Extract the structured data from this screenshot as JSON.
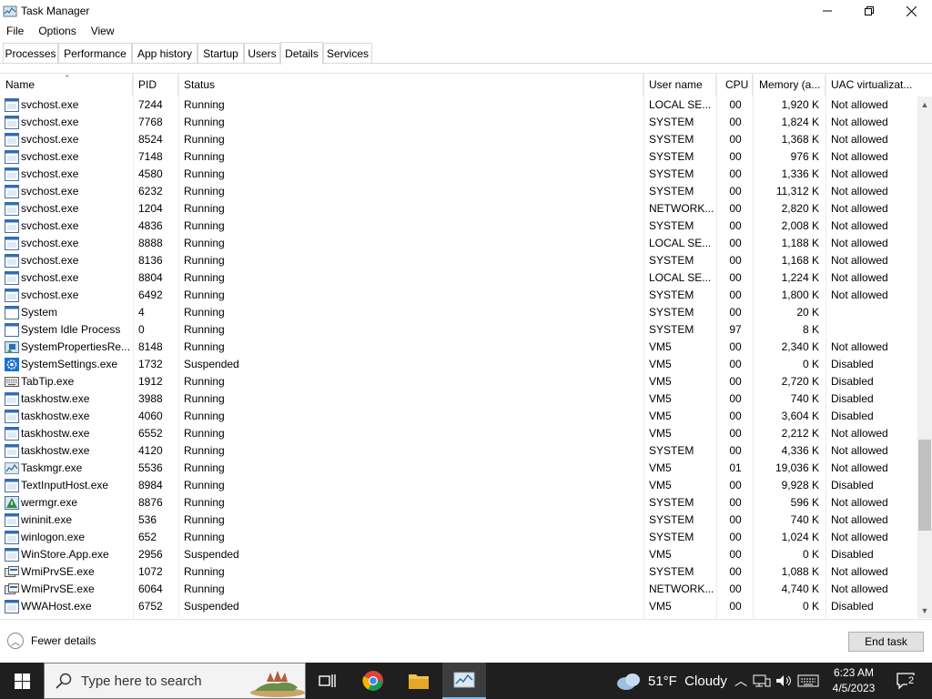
{
  "window": {
    "title": "Task Manager"
  },
  "menu": [
    "File",
    "Options",
    "View"
  ],
  "tabs": [
    {
      "label": "Processes"
    },
    {
      "label": "Performance"
    },
    {
      "label": "App history"
    },
    {
      "label": "Startup"
    },
    {
      "label": "Users"
    },
    {
      "label": "Details",
      "active": true
    },
    {
      "label": "Services"
    }
  ],
  "columns": {
    "name": "Name",
    "pid": "PID",
    "status": "Status",
    "user": "User name",
    "cpu": "CPU",
    "memory": "Memory (a...",
    "uac": "UAC virtualizat..."
  },
  "processes": [
    {
      "name": "svchost.exe",
      "pid": "7244",
      "status": "Running",
      "user": "LOCAL SE...",
      "cpu": "00",
      "memory": "1,920 K",
      "uac": "Not allowed",
      "icon": "svchost-icon"
    },
    {
      "name": "svchost.exe",
      "pid": "7768",
      "status": "Running",
      "user": "SYSTEM",
      "cpu": "00",
      "memory": "1,824 K",
      "uac": "Not allowed",
      "icon": "svchost-icon"
    },
    {
      "name": "svchost.exe",
      "pid": "8524",
      "status": "Running",
      "user": "SYSTEM",
      "cpu": "00",
      "memory": "1,368 K",
      "uac": "Not allowed",
      "icon": "svchost-icon"
    },
    {
      "name": "svchost.exe",
      "pid": "7148",
      "status": "Running",
      "user": "SYSTEM",
      "cpu": "00",
      "memory": "976 K",
      "uac": "Not allowed",
      "icon": "svchost-icon"
    },
    {
      "name": "svchost.exe",
      "pid": "4580",
      "status": "Running",
      "user": "SYSTEM",
      "cpu": "00",
      "memory": "1,336 K",
      "uac": "Not allowed",
      "icon": "svchost-icon"
    },
    {
      "name": "svchost.exe",
      "pid": "6232",
      "status": "Running",
      "user": "SYSTEM",
      "cpu": "00",
      "memory": "11,312 K",
      "uac": "Not allowed",
      "icon": "svchost-icon"
    },
    {
      "name": "svchost.exe",
      "pid": "1204",
      "status": "Running",
      "user": "NETWORK...",
      "cpu": "00",
      "memory": "2,820 K",
      "uac": "Not allowed",
      "icon": "svchost-icon"
    },
    {
      "name": "svchost.exe",
      "pid": "4836",
      "status": "Running",
      "user": "SYSTEM",
      "cpu": "00",
      "memory": "2,008 K",
      "uac": "Not allowed",
      "icon": "svchost-icon"
    },
    {
      "name": "svchost.exe",
      "pid": "8888",
      "status": "Running",
      "user": "LOCAL SE...",
      "cpu": "00",
      "memory": "1,188 K",
      "uac": "Not allowed",
      "icon": "svchost-icon"
    },
    {
      "name": "svchost.exe",
      "pid": "8136",
      "status": "Running",
      "user": "SYSTEM",
      "cpu": "00",
      "memory": "1,168 K",
      "uac": "Not allowed",
      "icon": "svchost-icon"
    },
    {
      "name": "svchost.exe",
      "pid": "8804",
      "status": "Running",
      "user": "LOCAL SE...",
      "cpu": "00",
      "memory": "1,224 K",
      "uac": "Not allowed",
      "icon": "svchost-icon"
    },
    {
      "name": "svchost.exe",
      "pid": "6492",
      "status": "Running",
      "user": "SYSTEM",
      "cpu": "00",
      "memory": "1,800 K",
      "uac": "Not allowed",
      "icon": "svchost-icon"
    },
    {
      "name": "System",
      "pid": "4",
      "status": "Running",
      "user": "SYSTEM",
      "cpu": "00",
      "memory": "20 K",
      "uac": "",
      "icon": "system-icon"
    },
    {
      "name": "System Idle Process",
      "pid": "0",
      "status": "Running",
      "user": "SYSTEM",
      "cpu": "97",
      "memory": "8 K",
      "uac": "",
      "icon": "system-icon"
    },
    {
      "name": "SystemPropertiesRe...",
      "pid": "8148",
      "status": "Running",
      "user": "VM5",
      "cpu": "00",
      "memory": "2,340 K",
      "uac": "Not allowed",
      "icon": "system-properties-icon"
    },
    {
      "name": "SystemSettings.exe",
      "pid": "1732",
      "status": "Suspended",
      "user": "VM5",
      "cpu": "00",
      "memory": "0 K",
      "uac": "Disabled",
      "icon": "settings-gear-icon"
    },
    {
      "name": "TabTip.exe",
      "pid": "1912",
      "status": "Running",
      "user": "VM5",
      "cpu": "00",
      "memory": "2,720 K",
      "uac": "Disabled",
      "icon": "keyboard-icon"
    },
    {
      "name": "taskhostw.exe",
      "pid": "3988",
      "status": "Running",
      "user": "VM5",
      "cpu": "00",
      "memory": "740 K",
      "uac": "Disabled",
      "icon": "svchost-icon"
    },
    {
      "name": "taskhostw.exe",
      "pid": "4060",
      "status": "Running",
      "user": "VM5",
      "cpu": "00",
      "memory": "3,604 K",
      "uac": "Disabled",
      "icon": "svchost-icon"
    },
    {
      "name": "taskhostw.exe",
      "pid": "6552",
      "status": "Running",
      "user": "VM5",
      "cpu": "00",
      "memory": "2,212 K",
      "uac": "Not allowed",
      "icon": "svchost-icon"
    },
    {
      "name": "taskhostw.exe",
      "pid": "4120",
      "status": "Running",
      "user": "SYSTEM",
      "cpu": "00",
      "memory": "4,336 K",
      "uac": "Not allowed",
      "icon": "svchost-icon"
    },
    {
      "name": "Taskmgr.exe",
      "pid": "5536",
      "status": "Running",
      "user": "VM5",
      "cpu": "01",
      "memory": "19,036 K",
      "uac": "Not allowed",
      "icon": "task-manager-icon"
    },
    {
      "name": "TextInputHost.exe",
      "pid": "8984",
      "status": "Running",
      "user": "VM5",
      "cpu": "00",
      "memory": "9,928 K",
      "uac": "Disabled",
      "icon": "svchost-icon"
    },
    {
      "name": "wermgr.exe",
      "pid": "8876",
      "status": "Running",
      "user": "SYSTEM",
      "cpu": "00",
      "memory": "596 K",
      "uac": "Not allowed",
      "icon": "wermgr-icon"
    },
    {
      "name": "wininit.exe",
      "pid": "536",
      "status": "Running",
      "user": "SYSTEM",
      "cpu": "00",
      "memory": "740 K",
      "uac": "Not allowed",
      "icon": "svchost-icon"
    },
    {
      "name": "winlogon.exe",
      "pid": "652",
      "status": "Running",
      "user": "SYSTEM",
      "cpu": "00",
      "memory": "1,024 K",
      "uac": "Not allowed",
      "icon": "svchost-icon"
    },
    {
      "name": "WinStore.App.exe",
      "pid": "2956",
      "status": "Suspended",
      "user": "VM5",
      "cpu": "00",
      "memory": "0 K",
      "uac": "Disabled",
      "icon": "svchost-icon"
    },
    {
      "name": "WmiPrvSE.exe",
      "pid": "1072",
      "status": "Running",
      "user": "SYSTEM",
      "cpu": "00",
      "memory": "1,088 K",
      "uac": "Not allowed",
      "icon": "wmi-icon"
    },
    {
      "name": "WmiPrvSE.exe",
      "pid": "6064",
      "status": "Running",
      "user": "NETWORK...",
      "cpu": "00",
      "memory": "4,740 K",
      "uac": "Not allowed",
      "icon": "wmi-icon"
    },
    {
      "name": "WWAHost.exe",
      "pid": "6752",
      "status": "Suspended",
      "user": "VM5",
      "cpu": "00",
      "memory": "0 K",
      "uac": "Disabled",
      "icon": "svchost-icon"
    }
  ],
  "footer": {
    "fewer_details": "Fewer details",
    "end_task": "End task"
  },
  "taskbar": {
    "search_placeholder": "Type here to search",
    "weather": "51°F  Cloudy",
    "time": "6:23 AM",
    "date": "4/5/2023",
    "notification_count": "2"
  },
  "scroll": {
    "position_fraction": 0.82
  },
  "colors": {
    "accent": "#76b9ed",
    "taskbar": "#1f1f1f",
    "button": "#e1e1e1"
  }
}
